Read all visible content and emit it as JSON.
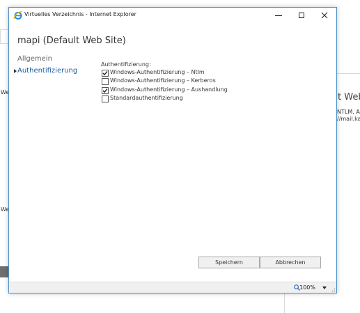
{
  "background": {
    "left_fragment_top": "We",
    "left_fragment_bottom": "We",
    "right_title_fragment": "t Web S",
    "right_line1": "NTLM, Au",
    "right_line2": "//mail.kar"
  },
  "window": {
    "title": "Virtuelles Verzeichnis - Internet Explorer"
  },
  "dialog": {
    "heading": "mapi (Default Web Site)",
    "nav": [
      {
        "label": "Allgemein",
        "active": false
      },
      {
        "label": "Authentifizierung",
        "active": true
      }
    ],
    "section_label": "Authentifizierung:",
    "checkboxes": [
      {
        "label": "Windows-Authentifizierung – Ntlm",
        "checked": true
      },
      {
        "label": "Windows-Authentifizierung – Kerberos",
        "checked": false
      },
      {
        "label": "Windows-Authentifizierung – Aushandlung",
        "checked": true
      },
      {
        "label": "Standardauthentifizierung",
        "checked": false
      }
    ],
    "save_label": "Speichern",
    "cancel_label": "Abbrechen"
  },
  "statusbar": {
    "zoom": "100%"
  },
  "colors": {
    "window_border": "#4a90c8",
    "active_nav": "#1f5ea8",
    "button_bg": "#f0f0f0"
  }
}
